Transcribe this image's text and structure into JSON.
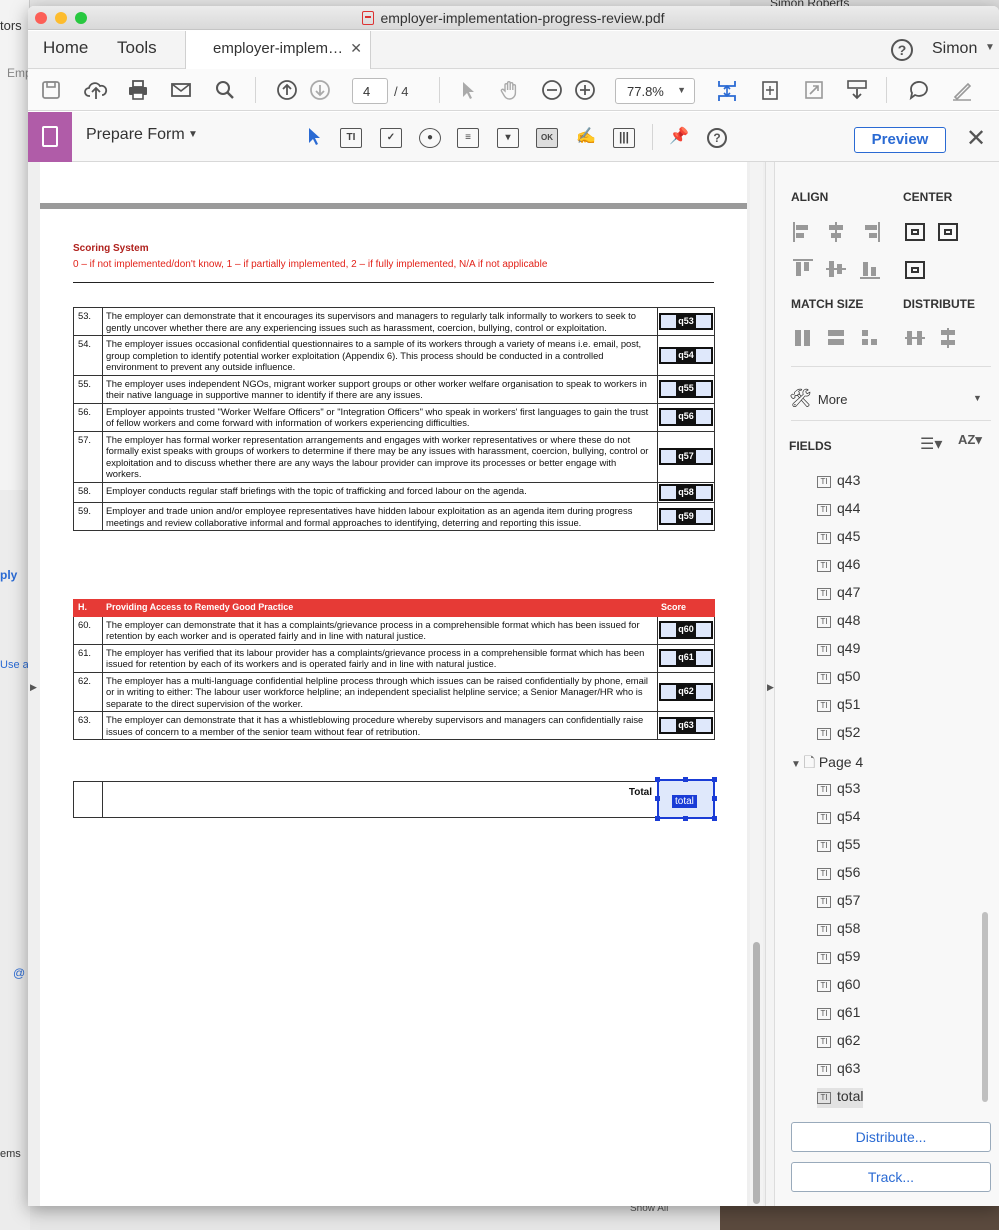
{
  "background": {
    "left_text_top": "tors",
    "left_text_2": "Emp",
    "left_text_3": "ply",
    "left_text_4": "Use ad",
    "left_text_5": "@",
    "left_text_6": "ems",
    "top_right_text": "Simon Roberts",
    "bottom_text": "Show All"
  },
  "window": {
    "title": "employer-implementation-progress-review.pdf"
  },
  "tabs": {
    "home": "Home",
    "tools": "Tools",
    "document": "employer-implem…",
    "user": "Simon"
  },
  "toolbar": {
    "page_current": "4",
    "page_total": "/ 4",
    "zoom": "77.8%"
  },
  "form": {
    "title": "Prepare Form",
    "preview": "Preview"
  },
  "document": {
    "scoring_title": "Scoring System",
    "scoring_text": "0 – if not implemented/don't know, 1 – if partially implemented, 2 – if fully implemented, N/A if not applicable",
    "rows_g": [
      {
        "num": "53.",
        "text": "The employer can demonstrate that it encourages its supervisors and managers to regularly talk informally to workers to seek to gently uncover whether there are any experiencing issues such as harassment, coercion, bullying, control or exploitation.",
        "field": "q53"
      },
      {
        "num": "54.",
        "text": "The employer issues occasional confidential questionnaires to a sample of its workers through a variety of means i.e. email, post, group completion to identify potential worker exploitation (Appendix 6). This process should be conducted in a controlled environment to prevent any outside influence.",
        "field": "q54"
      },
      {
        "num": "55.",
        "text": "The employer uses independent NGOs, migrant worker support groups or other worker welfare organisation to speak to workers in their native language in supportive manner to identify if there are any issues.",
        "field": "q55"
      },
      {
        "num": "56.",
        "text": "Employer appoints trusted \"Worker Welfare Officers\" or \"Integration Officers\" who speak in workers' first languages to gain the trust of fellow workers and come forward with information of workers experiencing difficulties.",
        "field": "q56"
      },
      {
        "num": "57.",
        "text": "The employer has formal worker representation arrangements and engages with worker representatives or where these do not formally exist speaks with groups of workers to determine if there may be any issues with harassment, coercion, bullying, control or exploitation and to discuss whether there are any ways the labour provider can improve its processes or better engage with workers.",
        "field": "q57"
      },
      {
        "num": "58.",
        "text": "Employer conducts regular staff briefings with the topic of trafficking and forced labour on the agenda.",
        "field": "q58"
      },
      {
        "num": "59.",
        "text": "Employer and trade union and/or employee representatives have hidden labour exploitation as an agenda item during progress meetings and review collaborative informal and formal approaches to identifying, deterring and reporting this issue.",
        "field": "q59"
      }
    ],
    "section_h": {
      "num": "H.",
      "title": "Providing Access to Remedy Good Practice",
      "score": "Score"
    },
    "rows_h": [
      {
        "num": "60.",
        "text": "The employer can demonstrate that it has a complaints/grievance process in a comprehensible format which has been issued for retention by each worker and is operated fairly and in line with natural justice.",
        "field": "q60"
      },
      {
        "num": "61.",
        "text": "The employer has verified that its labour provider has a complaints/grievance process in a comprehensible format which has been issued for retention by each of its workers and is operated fairly and in line with natural justice.",
        "field": "q61"
      },
      {
        "num": "62.",
        "text": "The employer has a multi-language confidential helpline process through which issues can be raised confidentially by phone, email or in writing to either: The labour user workforce helpline; an independent specialist helpline service; a Senior Manager/HR who is separate to the direct supervision of the worker.",
        "field": "q62"
      },
      {
        "num": "63.",
        "text": "The employer can demonstrate that it has a whistleblowing procedure whereby supervisors and managers can confidentially raise issues of concern to a member of the senior team without fear of retribution.",
        "field": "q63"
      }
    ],
    "total_label": "Total",
    "total_field": "total"
  },
  "panel": {
    "align": "ALIGN",
    "center": "CENTER",
    "match_size": "MATCH SIZE",
    "distribute": "DISTRIBUTE",
    "more": "More",
    "fields": "FIELDS",
    "page4": "Page 4",
    "fields_page3": [
      "q43",
      "q44",
      "q45",
      "q46",
      "q47",
      "q48",
      "q49",
      "q50",
      "q51",
      "q52"
    ],
    "fields_page4": [
      "q53",
      "q54",
      "q55",
      "q56",
      "q57",
      "q58",
      "q59",
      "q60",
      "q61",
      "q62",
      "q63",
      "total"
    ],
    "distribute_btn": "Distribute...",
    "track_btn": "Track..."
  },
  "colors": {
    "accent_blue": "#2a6ad3",
    "form_badge": "#b05ca8",
    "section_red": "#e63a36",
    "field_fill": "#dfe8fb",
    "selected_field": "#1a3cd6"
  }
}
